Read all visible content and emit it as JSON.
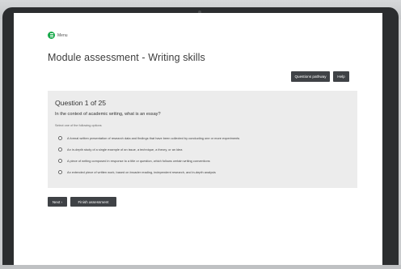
{
  "menu": {
    "label": "Menu",
    "icon": "menu-icon"
  },
  "page": {
    "title": "Module assessment - Writing skills"
  },
  "toolbar": {
    "questions_pathway_label": "Questions pathway",
    "help_label": "Help"
  },
  "question": {
    "header": "Question 1 of 25",
    "text": "In the context of academic writing, what is an essay?",
    "instruction": "Select one of the following options",
    "options": [
      "A formal written presentation of research data and findings that have been collected by conducting one or more experiments",
      "An in-depth study of a single example of an issue, a technique, a theory, or an idea",
      "A piece of writing composed in response to a title or question, which follows certain writing conventions",
      "An extended piece of written work, based on broader reading, independent research, and in-depth analysis"
    ]
  },
  "footer": {
    "next_label": "Next ›",
    "finish_label": "Finish assessment"
  },
  "colors": {
    "accent": "#18a94a",
    "button": "#3f4246",
    "panel": "#ececec"
  }
}
